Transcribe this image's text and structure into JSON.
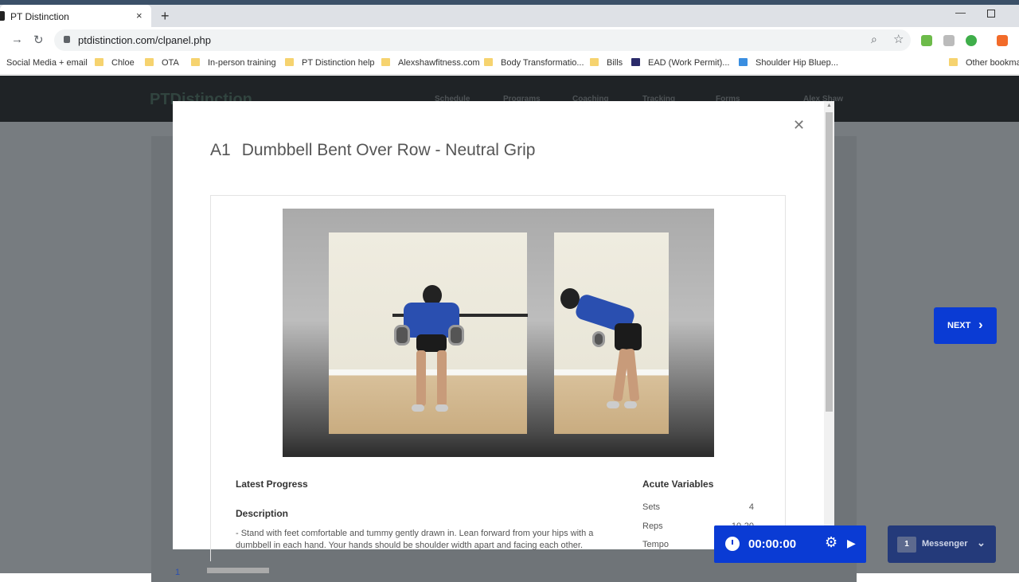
{
  "browser": {
    "tab_title": "PT Distinction",
    "tab_close": "×",
    "new_tab": "+",
    "url": "ptdistinction.com/clpanel.php",
    "bookmarks": [
      {
        "label": "Social Media + email"
      },
      {
        "label": "Chloe"
      },
      {
        "label": "OTA"
      },
      {
        "label": "In-person training"
      },
      {
        "label": "PT Distinction help"
      },
      {
        "label": "Alexshawfitness.com"
      },
      {
        "label": "Body Transformatio..."
      },
      {
        "label": "Bills"
      },
      {
        "label": "EAD (Work Permit)..."
      },
      {
        "label": "Shoulder Hip Bluep..."
      },
      {
        "label": "Other bookma"
      }
    ]
  },
  "app": {
    "logo": "PTDistinction",
    "nav": [
      "Schedule",
      "Programs",
      "Coaching",
      "Tracking",
      "Forms"
    ],
    "user": "Alex Shaw"
  },
  "exercise": {
    "code": "A1",
    "name": "Dumbbell Bent Over Row - Neutral Grip",
    "latest_progress_title": "Latest Progress",
    "description_title": "Description",
    "description": "- Stand with feet comfortable and tummy gently drawn in. Lean forward from your hips with a dumbbell in each hand. Your hands should be shoulder width apart and facing each other.",
    "acute_title": "Acute Variables",
    "variables": [
      {
        "label": "Sets",
        "value": "4"
      },
      {
        "label": "Reps",
        "value": "10-20"
      },
      {
        "label": "Tempo",
        "value": ""
      }
    ]
  },
  "next_button": "NEXT",
  "timer": {
    "time": "00:00:00"
  },
  "messenger": {
    "label": "Messenger",
    "badge": "1"
  },
  "pager": {
    "page": "1"
  }
}
